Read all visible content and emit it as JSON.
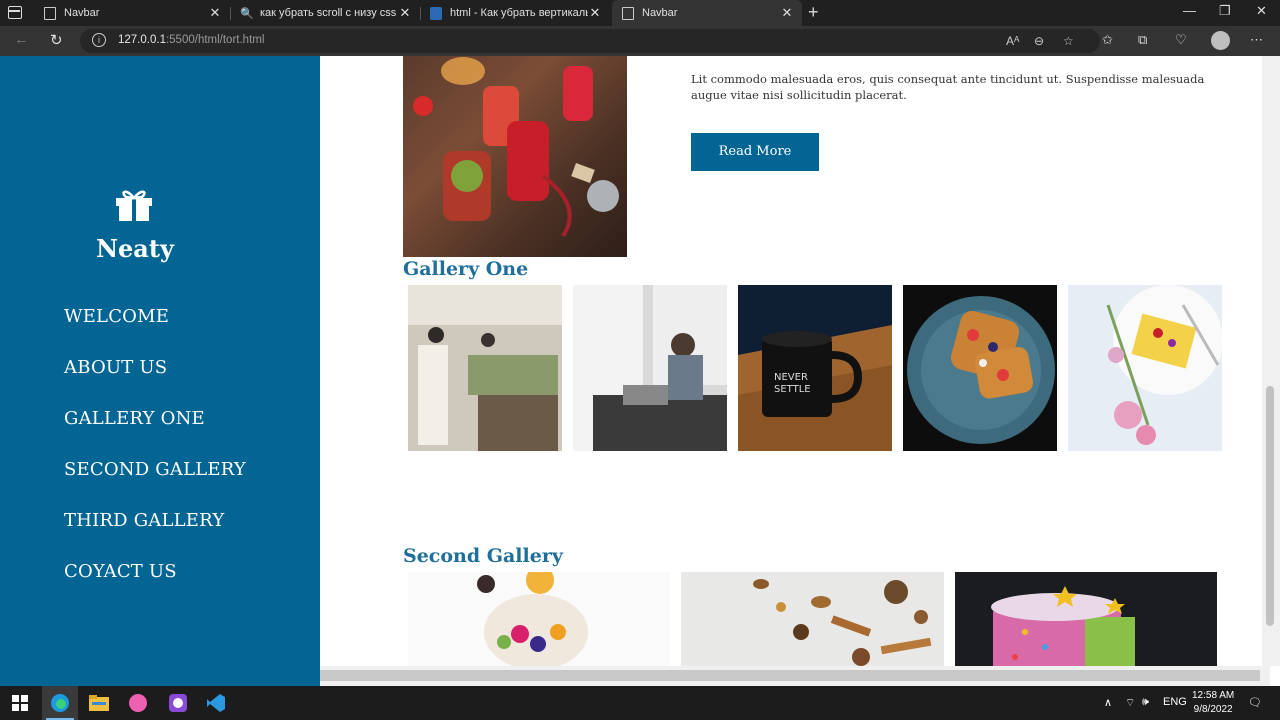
{
  "browser": {
    "tabs": [
      {
        "label": "Navbar",
        "icon": "page-icon"
      },
      {
        "label": "как убрать scroll с низу css - По",
        "icon": "search-icon"
      },
      {
        "label": "html - Как убрать вертикальны",
        "icon": "stackoverflow-icon"
      },
      {
        "label": "Navbar",
        "icon": "page-icon",
        "active": true
      }
    ],
    "url_host": "127.0.0.1",
    "url_rest": ":5500/html/tort.html"
  },
  "sidebar": {
    "brand": "Neaty",
    "nav": [
      "WELCOME",
      "ABOUT US",
      "GALLERY ONE",
      "SECOND GALLERY",
      "THIRD GALLERY",
      "COYACT US"
    ]
  },
  "content": {
    "paragraph": "Lit commodo malesuada eros, quis consequat ante tincidunt ut. Suspendisse malesuada augue vitae nisi sollicitudin placerat.",
    "read_more": "Read More",
    "gallery_one_title": "Gallery One",
    "second_gallery_title": "Second Gallery"
  },
  "taskbar": {
    "lang": "ENG",
    "time": "12:58 AM",
    "date": "9/8/2022"
  },
  "colors": {
    "accent": "#036594",
    "heading": "#1f6f9a"
  }
}
